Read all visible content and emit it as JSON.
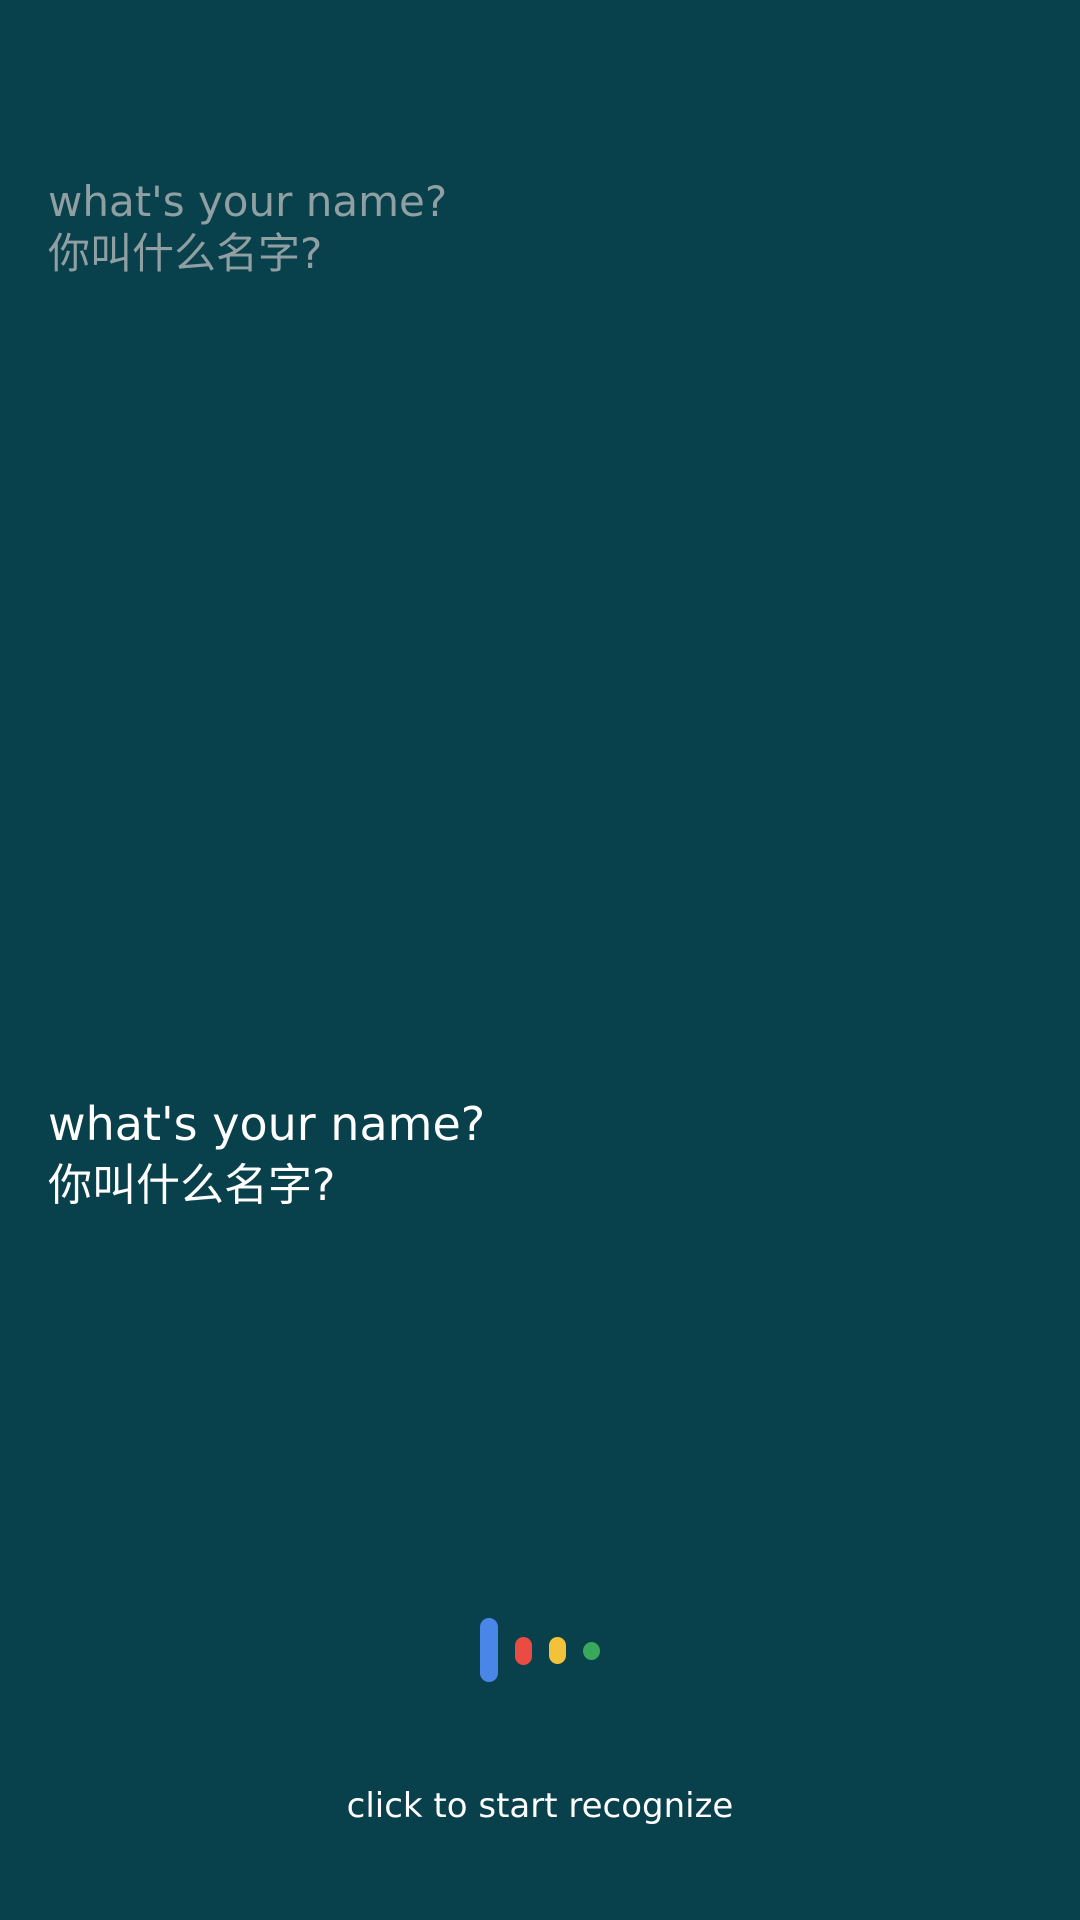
{
  "hint": {
    "english": "what's your name?",
    "chinese": "你叫什么名字?"
  },
  "result": {
    "english": "what's your name?",
    "chinese": "你叫什么名字?"
  },
  "voice_indicator": {
    "icon": "voice-dots-icon",
    "colors": {
      "blue": "#4a86e8",
      "red": "#ea4c43",
      "yellow": "#f3c13a",
      "green": "#39a85a"
    }
  },
  "action": {
    "label": "click to start recognize"
  },
  "colors": {
    "background": "#08404c",
    "hint_text": "#8f9fa2",
    "result_text": "#ffffff"
  }
}
